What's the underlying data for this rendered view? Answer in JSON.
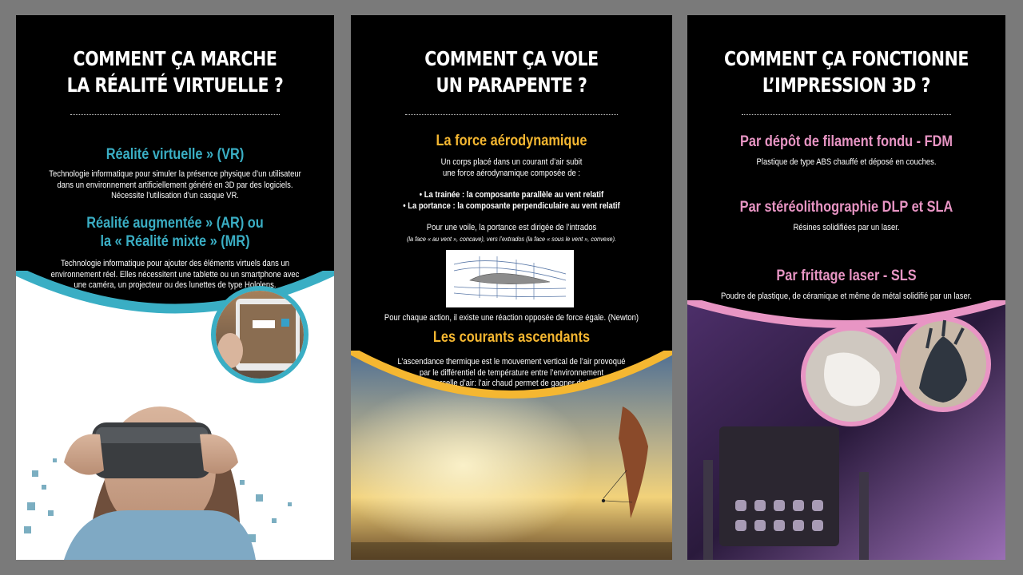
{
  "panel1": {
    "title": [
      "COMMENT ÇA MARCHE",
      "LA RÉALITÉ VIRTUELLE ?"
    ],
    "heading1": "Réalité virtuelle » (VR)",
    "text1": [
      "Technologie informatique pour simuler la présence physique d’un utilisateur",
      "dans un environnement artificiellement généré en 3D par des logiciels.",
      "Nécessite l’utilisation d’un casque VR."
    ],
    "heading2": [
      "Réalité augmentée » (AR) ou",
      "la « Réalité mixte » (MR)"
    ],
    "text2": [
      "Technologie informatique pour ajouter des éléments virtuels dans un",
      "environnement réel. Elles nécessitent une tablette ou un smartphone avec",
      "une caméra, un projecteur ou des lunettes de type Hololens."
    ],
    "accent": "#3aaec4"
  },
  "panel2": {
    "title": [
      "COMMENT ÇA VOLE",
      "UN PARAPENTE ?"
    ],
    "heading1": "La force aérodynamique",
    "intro": [
      "Un corps placé dans un courant d’air subit",
      "une force aérodynamique composée de :"
    ],
    "bullets": [
      "• La trainée : la composante parallèle au vent relatif",
      "• La portance : la composante perpendiculaire au vent relatif"
    ],
    "para": "Pour une voile, la portance est dirigée de l’intrados",
    "para_small": "(la face « au vent », concave), vers l’extrados (la face « sous le vent », convexe).",
    "newton": "Pour chaque action, il existe une réaction opposée de force égale. (Newton)",
    "heading2": "Les courants ascendants",
    "text2": [
      "L’ascendance thermique est le mouvement vertical de l’air provoqué",
      "par le différentiel de température entre l’environnement",
      "et une parcelle d’air: l’air chaud permet de gagner de l’altitude"
    ],
    "accent": "#f5b731"
  },
  "panel3": {
    "title": [
      "COMMENT ÇA FONCTIONNE",
      "L’IMPRESSION 3D ?"
    ],
    "heading1": "Par dépôt de filament fondu - FDM",
    "text1": "Plastique de type ABS chauffé et déposé en couches.",
    "heading2": "Par stéréolithographie DLP et SLA",
    "text2": "Résines solidifiées par un laser.",
    "heading3": "Par frittage laser - SLS",
    "text3": "Poudre de plastique, de céramique et même de métal solidifié par un laser.",
    "accent": "#e895c4"
  }
}
